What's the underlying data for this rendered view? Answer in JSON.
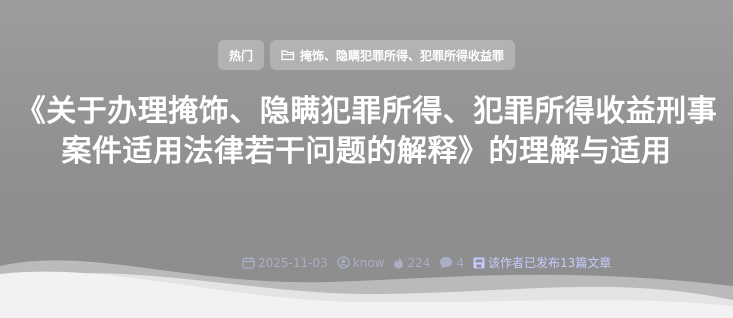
{
  "tags": {
    "hot_label": "热门",
    "folder_icon": "folder-icon",
    "category_label": "掩饰、隐瞒犯罪所得、犯罪所得收益罪"
  },
  "article": {
    "title": "《关于办理掩饰、隐瞒犯罪所得、犯罪所得收益刑事案件适用法律若干问题的解释》的理解与适用"
  },
  "meta": {
    "date": "2025-11-03",
    "author": "know",
    "views": "224",
    "comments": "4",
    "author_posts_notice": "该作者已发布13篇文章",
    "icons": [
      "calendar-icon",
      "user-icon",
      "fire-icon",
      "comment-icon",
      "article-icon"
    ]
  },
  "colors": {
    "background": "#939393",
    "text": "#ffffff",
    "meta_text": "#c7cbff",
    "wave": "#f2f2f4"
  }
}
